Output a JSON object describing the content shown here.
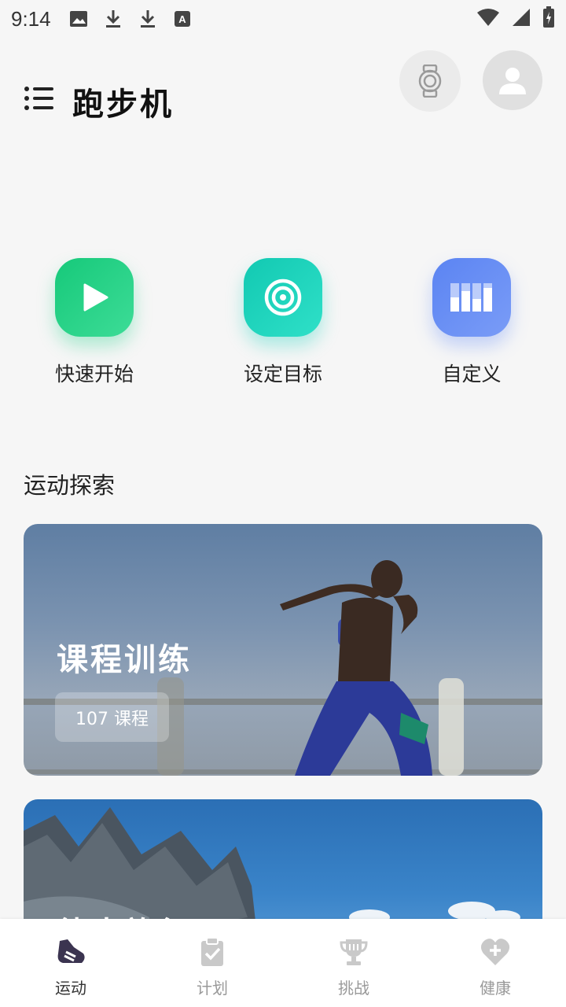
{
  "status_bar": {
    "time": "9:14",
    "icons": [
      "image-icon",
      "download-icon",
      "download-icon",
      "font-a-icon"
    ],
    "right_icons": [
      "wifi-icon",
      "cellular-signal-icon",
      "battery-charging-icon"
    ]
  },
  "header": {
    "title": "跑步机",
    "menu_icon": "menu-icon",
    "watch_icon": "watch-icon",
    "avatar_icon": "user-icon"
  },
  "actions": [
    {
      "label": "快速开始",
      "icon": "play-icon",
      "color": "#1ccf86"
    },
    {
      "label": "设定目标",
      "icon": "target-icon",
      "color": "#1cd3bd"
    },
    {
      "label": "自定义",
      "icon": "bars-icon",
      "color": "#6a8ef4"
    }
  ],
  "explore": {
    "title": "运动探索",
    "cards": [
      {
        "title": "课程训练",
        "badge": "107 课程"
      },
      {
        "title": "徒步旅行",
        "badge": ""
      }
    ]
  },
  "bottom_nav": {
    "items": [
      {
        "label": "运动",
        "icon": "shoe-icon",
        "active": true
      },
      {
        "label": "计划",
        "icon": "clipboard-check-icon",
        "active": false
      },
      {
        "label": "挑战",
        "icon": "trophy-icon",
        "active": false
      },
      {
        "label": "健康",
        "icon": "heart-plus-icon",
        "active": false
      }
    ]
  }
}
